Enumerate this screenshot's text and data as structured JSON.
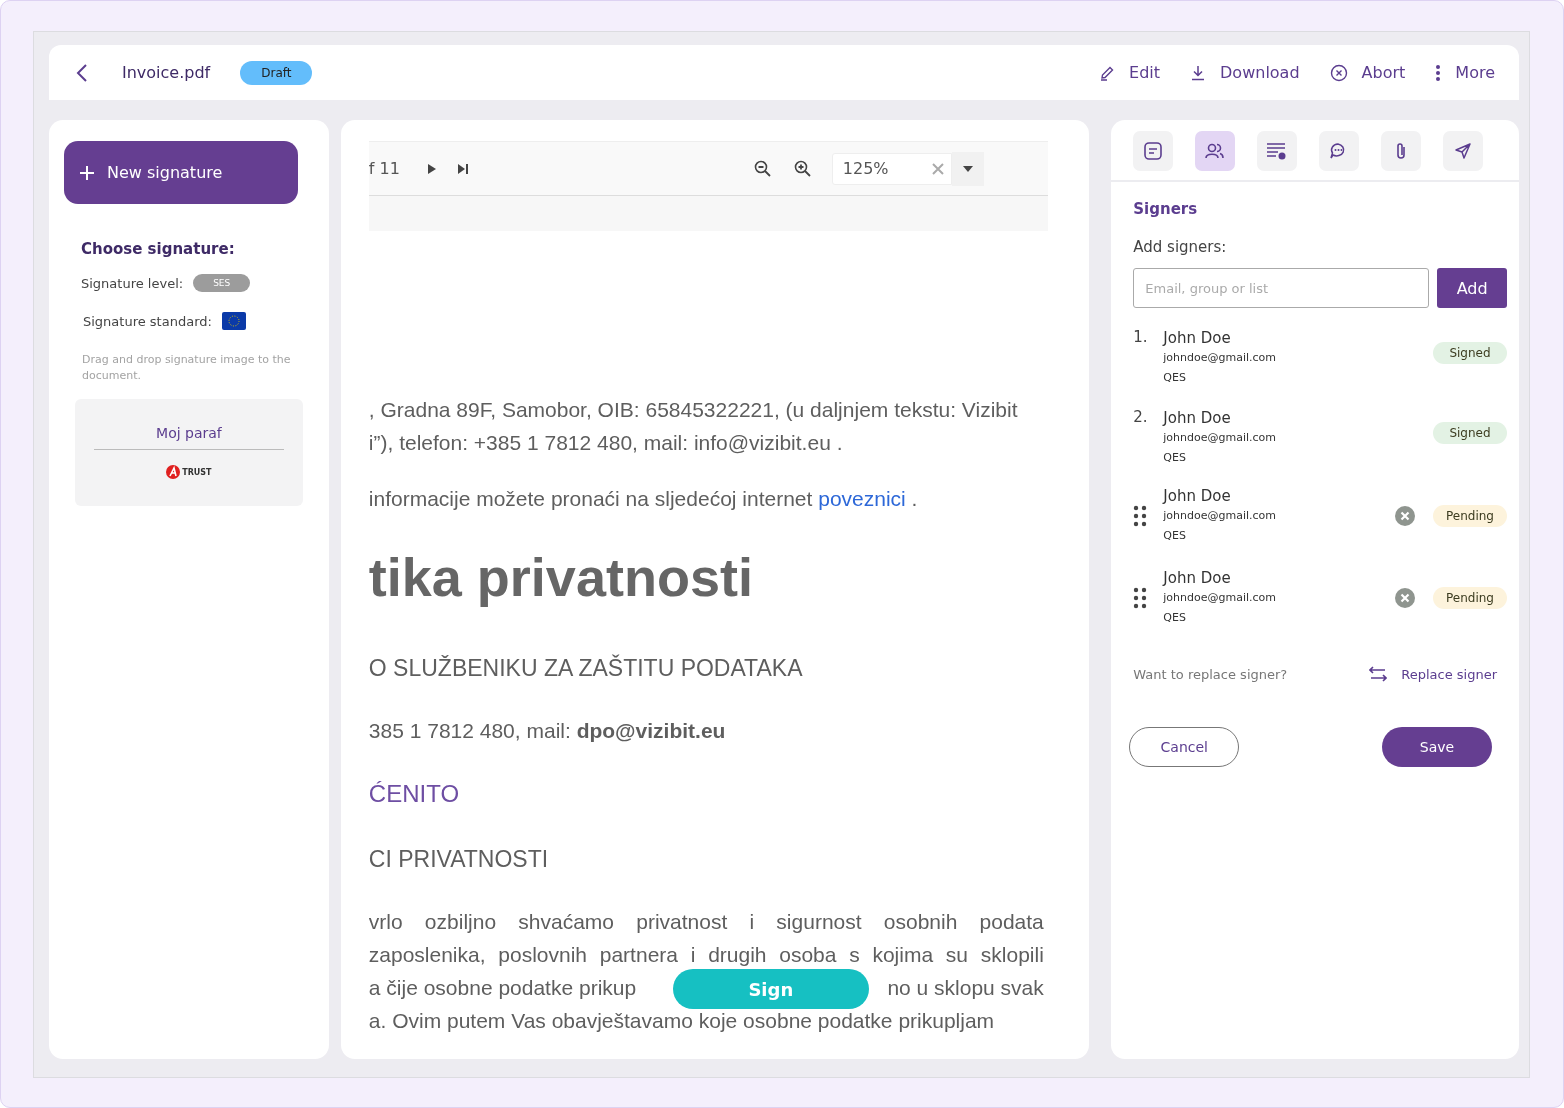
{
  "header": {
    "title": "Invoice.pdf",
    "status": "Draft",
    "actions": [
      {
        "kind": "edit",
        "label": "Edit"
      },
      {
        "kind": "download",
        "label": "Download"
      },
      {
        "kind": "abort",
        "label": "Abort"
      },
      {
        "kind": "more",
        "label": "More"
      }
    ]
  },
  "signature_panel": {
    "new_button": "New signature",
    "heading": "Choose signature:",
    "level_label": "Signature level:",
    "level_value": "SES",
    "standard_label": "Signature standard:",
    "hint": "Drag and drop signature image to the document.",
    "card": {
      "name": "Moj paraf",
      "logo_text": "TRUST"
    }
  },
  "viewer": {
    "page_count": "f 11",
    "zoom": "125%",
    "lines": [
      {
        "kind": "text",
        "text": ", Gradna 89F, Samobor, OIB: 65845322221, (u daljnjem tekstu: Vizibit"
      },
      {
        "kind": "text",
        "text": "i”), telefon: +385 1 7812 480, mail: info@vizibit.eu ."
      },
      {
        "kind": "link-line",
        "text": "informacije možete pronaći na sljedećoj internet",
        "link": "poveznici",
        "after": "."
      },
      {
        "kind": "title",
        "text": "tika privatnosti"
      },
      {
        "kind": "caps",
        "text": "O SLUŽBENIKU ZA ZAŠTITU PODATAKA"
      },
      {
        "kind": "text",
        "text": "385 1 7812 480, mail: **dpo@vizibit.eu**"
      },
      {
        "kind": "accent",
        "text": "ĆENITO"
      },
      {
        "kind": "caps",
        "text": "CI PRIVATNOSTI"
      },
      {
        "kind": "justified",
        "text": "vrlo ozbiljno shvaćamo privatnost i sigurnost osobnih podata"
      },
      {
        "kind": "justified",
        "text": "zaposlenika, poslovnih partnera i drugih osoba s kojima su sklopili"
      },
      {
        "kind": "split",
        "text": "a čije osobne podatke prikup",
        "after": "no u sklopu svak"
      },
      {
        "kind": "text",
        "text": "a. Ovim putem Vas obavještavamo koje osobne podatke prikupljam"
      }
    ],
    "sign_button": "Sign"
  },
  "signers_panel": {
    "tabs": [
      {
        "kind": "document",
        "selected": false
      },
      {
        "kind": "people",
        "selected": true
      },
      {
        "kind": "list-settings",
        "selected": false
      },
      {
        "kind": "chat",
        "selected": false
      },
      {
        "kind": "attachment",
        "selected": false
      },
      {
        "kind": "send",
        "selected": false
      }
    ],
    "title": "Signers",
    "add_label": "Add signers:",
    "input": {
      "placeholder": "Email, group or list"
    },
    "add_button": "Add",
    "signers": [
      {
        "kind": "numbered",
        "index": "1.",
        "name": "John Doe",
        "email": "johndoe@gmail.com",
        "level": "QES",
        "status": "Signed",
        "color": "#e3f2e4"
      },
      {
        "kind": "numbered",
        "index": "2.",
        "name": "John Doe",
        "email": "johndoe@gmail.com",
        "level": "QES",
        "status": "Signed",
        "color": "#e3f2e4"
      },
      {
        "kind": "draggable",
        "name": "John Doe",
        "email": "johndoe@gmail.com",
        "level": "QES",
        "status": "Pending",
        "color": "#fdf3dc"
      },
      {
        "kind": "draggable",
        "name": "John Doe",
        "email": "johndoe@gmail.com",
        "level": "QES",
        "status": "Pending",
        "color": "#fdf3dc"
      }
    ],
    "replace_prompt": "Want to replace signer?",
    "replace_link": "Replace signer",
    "cancel": "Cancel",
    "save": "Save"
  }
}
